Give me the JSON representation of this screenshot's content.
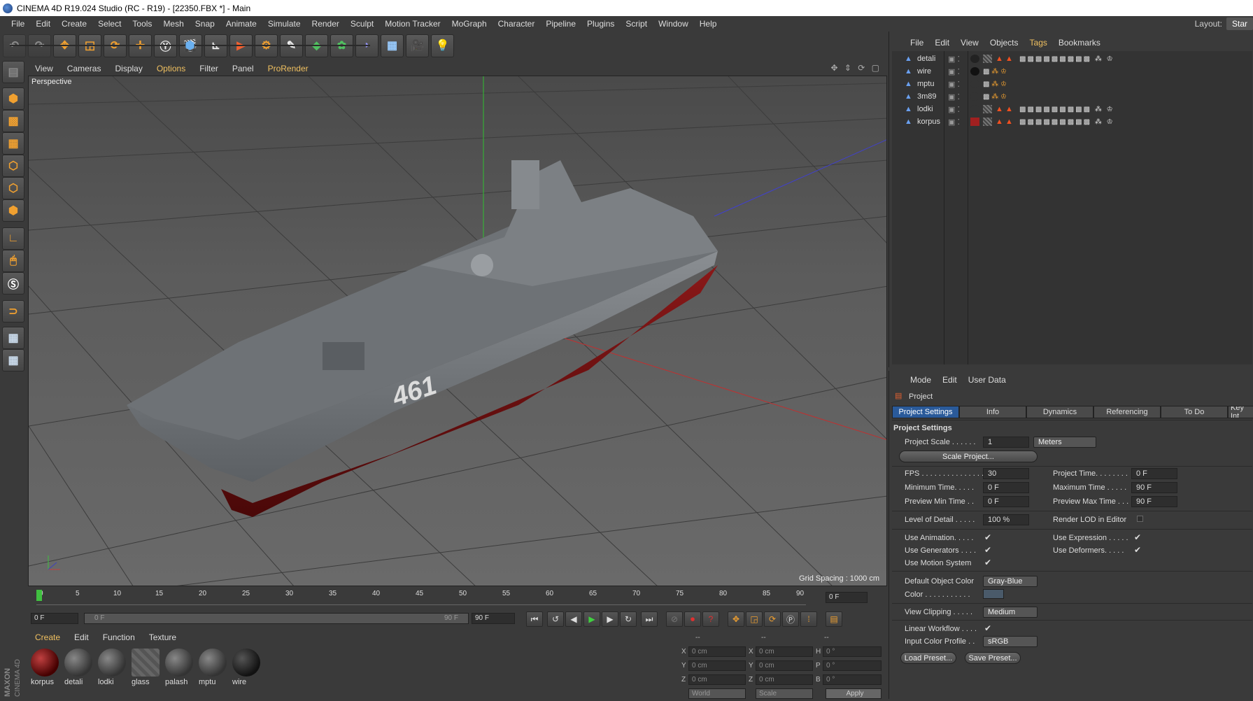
{
  "window": {
    "title": "CINEMA 4D R19.024 Studio (RC - R19) - [22350.FBX *] - Main"
  },
  "menubar": {
    "items": [
      "File",
      "Edit",
      "Create",
      "Select",
      "Tools",
      "Mesh",
      "Snap",
      "Animate",
      "Simulate",
      "Render",
      "Sculpt",
      "Motion Tracker",
      "MoGraph",
      "Character",
      "Pipeline",
      "Plugins",
      "Script",
      "Window",
      "Help"
    ],
    "layout_label": "Layout:",
    "layout_value": "Star"
  },
  "viewport": {
    "menu": [
      "View",
      "Cameras",
      "Display",
      "Options",
      "Filter",
      "Panel",
      "ProRender"
    ],
    "label": "Perspective",
    "grid_spacing": "Grid Spacing : 1000 cm",
    "hull_number": "461"
  },
  "timeline": {
    "ticks": [
      "0",
      "5",
      "10",
      "15",
      "20",
      "25",
      "30",
      "35",
      "40",
      "45",
      "50",
      "55",
      "60",
      "65",
      "70",
      "75",
      "80",
      "85",
      "90"
    ],
    "current_frame": "0 F",
    "start": "0 F",
    "range_start": "0 F",
    "range_end": "90 F",
    "end": "90 F"
  },
  "materials": {
    "menu": [
      "Create",
      "Edit",
      "Function",
      "Texture"
    ],
    "items": [
      "korpus",
      "detali",
      "lodki",
      "glass",
      "palash",
      "mptu",
      "wire"
    ]
  },
  "coords": {
    "headers": [
      "--",
      "--",
      "--"
    ],
    "rows": [
      {
        "a": "X",
        "av": "0 cm",
        "b": "X",
        "bv": "0 cm",
        "c": "H",
        "cv": "0 °"
      },
      {
        "a": "Y",
        "av": "0 cm",
        "b": "Y",
        "bv": "0 cm",
        "c": "P",
        "cv": "0 °"
      },
      {
        "a": "Z",
        "av": "0 cm",
        "b": "Z",
        "bv": "0 cm",
        "c": "B",
        "cv": "0 °"
      }
    ],
    "mode1": "World",
    "mode2": "Scale",
    "apply": "Apply"
  },
  "objects": {
    "menu": [
      "File",
      "Edit",
      "View",
      "Objects",
      "Tags",
      "Bookmarks"
    ],
    "list": [
      "detali",
      "wire",
      "mptu",
      "3m89",
      "lodki",
      "korpus"
    ]
  },
  "attributes": {
    "menu": [
      "Mode",
      "Edit",
      "User Data"
    ],
    "object": "Project",
    "tabs": [
      "Project Settings",
      "Info",
      "Dynamics",
      "Referencing",
      "To Do",
      "Key Int"
    ],
    "section": "Project Settings",
    "project_scale_label": "Project Scale . . . . . .",
    "project_scale_value": "1",
    "project_scale_unit": "Meters",
    "scale_project_btn": "Scale Project...",
    "fps_label": "FPS . . . . . . . . . . . . . . .",
    "fps_value": "30",
    "project_time_label": "Project Time. . . . . . . .",
    "project_time_value": "0 F",
    "min_time_label": "Minimum Time. . . . .",
    "min_time_value": "0 F",
    "max_time_label": "Maximum Time . . . . .",
    "max_time_value": "90 F",
    "prev_min_label": "Preview Min Time . .",
    "prev_min_value": "0 F",
    "prev_max_label": "Preview Max Time . . .",
    "prev_max_value": "90 F",
    "lod_label": "Level of Detail . . . . .",
    "lod_value": "100 %",
    "render_lod_label": "Render LOD in Editor",
    "use_anim_label": "Use Animation. . . . .",
    "use_expr_label": "Use Expression . . . . .",
    "use_gen_label": "Use Generators . . . .",
    "use_def_label": "Use Deformers. . . . .",
    "use_motion_label": "Use Motion System",
    "def_color_label": "Default Object Color",
    "def_color_value": "Gray-Blue",
    "color_label": "Color . . . . . . . . . . .",
    "view_clip_label": "View Clipping . . . . .",
    "view_clip_value": "Medium",
    "linear_label": "Linear Workflow . . . .",
    "input_profile_label": "Input Color Profile . .",
    "input_profile_value": "sRGB",
    "load_preset": "Load Preset...",
    "save_preset": "Save Preset..."
  }
}
